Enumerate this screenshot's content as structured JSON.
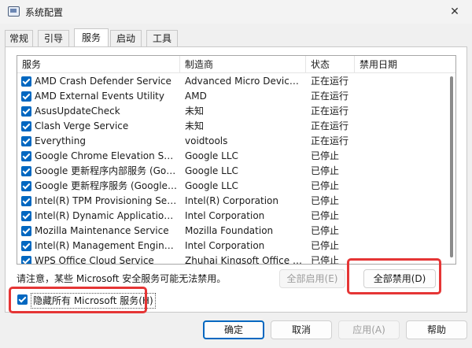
{
  "window": {
    "title": "系统配置",
    "close_glyph": "✕"
  },
  "tabs": [
    {
      "label": "常规"
    },
    {
      "label": "引导"
    },
    {
      "label": "服务",
      "active": true
    },
    {
      "label": "启动"
    },
    {
      "label": "工具"
    }
  ],
  "columns": {
    "service": "服务",
    "manufacturer": "制造商",
    "status": "状态",
    "disabled_date": "禁用日期"
  },
  "services": [
    {
      "name": "AMD Crash Defender Service",
      "manufacturer": "Advanced Micro Devices, I...",
      "status": "正在运行",
      "checked": true
    },
    {
      "name": "AMD External Events Utility",
      "manufacturer": "AMD",
      "status": "正在运行",
      "checked": true
    },
    {
      "name": "AsusUpdateCheck",
      "manufacturer": "未知",
      "status": "正在运行",
      "checked": true
    },
    {
      "name": "Clash Verge Service",
      "manufacturer": "未知",
      "status": "正在运行",
      "checked": true
    },
    {
      "name": "Everything",
      "manufacturer": "voidtools",
      "status": "正在运行",
      "checked": true
    },
    {
      "name": "Google Chrome Elevation Servic...",
      "manufacturer": "Google LLC",
      "status": "已停止",
      "checked": true
    },
    {
      "name": "Google 更新程序内部服务 (Googl...",
      "manufacturer": "Google LLC",
      "status": "已停止",
      "checked": true
    },
    {
      "name": "Google 更新程序服务 (GoogleUp...",
      "manufacturer": "Google LLC",
      "status": "已停止",
      "checked": true
    },
    {
      "name": "Intel(R) TPM Provisioning Service",
      "manufacturer": "Intel(R) Corporation",
      "status": "已停止",
      "checked": true
    },
    {
      "name": "Intel(R) Dynamic Application Loa...",
      "manufacturer": "Intel Corporation",
      "status": "已停止",
      "checked": true
    },
    {
      "name": "Mozilla Maintenance Service",
      "manufacturer": "Mozilla Foundation",
      "status": "已停止",
      "checked": true
    },
    {
      "name": "Intel(R) Management Engine WM...",
      "manufacturer": "Intel Corporation",
      "status": "已停止",
      "checked": true
    },
    {
      "name": "WPS Office Cloud Service",
      "manufacturer": "Zhuhai Kingsoft Office Soft...",
      "status": "已停止",
      "checked": true
    }
  ],
  "notice": "请注意，某些 Microsoft 安全服务可能无法禁用。",
  "buttons": {
    "enable_all": "全部启用(E)",
    "disable_all": "全部禁用(D)",
    "ok": "确定",
    "cancel": "取消",
    "apply": "应用(A)",
    "help": "帮助"
  },
  "hide_ms": {
    "label": "隐藏所有 Microsoft 服务(H)",
    "checked": true
  },
  "colors": {
    "accent": "#0067c0",
    "highlight": "#e53535"
  }
}
